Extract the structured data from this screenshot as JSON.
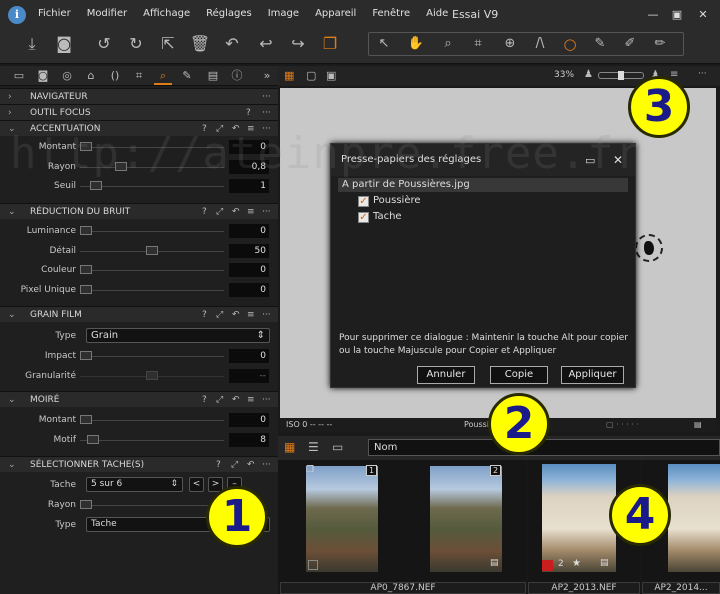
{
  "app": {
    "title": "Essai V9"
  },
  "menu": [
    "Fichier",
    "Modifier",
    "Affichage",
    "Réglages",
    "Image",
    "Appareil",
    "Fenêtre",
    "Aide"
  ],
  "watermark": "http://ateinpre.free.fr",
  "viewer": {
    "zoom": "33%",
    "info_left": "ISO 0 -- -- --",
    "info_center": "Poussi"
  },
  "sections": {
    "navigateur": "NAVIGATEUR",
    "outil_focus": "OUTIL FOCUS",
    "accentuation": {
      "title": "ACCENTUATION",
      "rows": [
        {
          "label": "Montant",
          "value": "0"
        },
        {
          "label": "Rayon",
          "value": "0,8"
        },
        {
          "label": "Seuil",
          "value": "1"
        }
      ]
    },
    "reduction": {
      "title": "RÉDUCTION DU BRUIT",
      "rows": [
        {
          "label": "Luminance",
          "value": "0"
        },
        {
          "label": "Détail",
          "value": "50"
        },
        {
          "label": "Couleur",
          "value": "0"
        },
        {
          "label": "Pixel Unique",
          "value": "0"
        }
      ]
    },
    "grain": {
      "title": "GRAIN FILM",
      "type_label": "Type",
      "type_value": "Grain",
      "rows": [
        {
          "label": "Impact",
          "value": "0"
        },
        {
          "label": "Granularité",
          "value": "--"
        }
      ]
    },
    "moire": {
      "title": "MOIRÉ",
      "rows": [
        {
          "label": "Montant",
          "value": "0"
        },
        {
          "label": "Motif",
          "value": "8"
        }
      ]
    },
    "tache": {
      "title": "SÉLECTIONNER TACHE(S)",
      "tache_label": "Tache",
      "tache_value": "5 sur 6",
      "prev": "<",
      "next": ">",
      "rayon_label": "Rayon",
      "type_label": "Type",
      "type_value": "Tache"
    }
  },
  "dialog": {
    "title": "Presse-papiers des réglages",
    "source": "A partir de Poussières.jpg",
    "items": [
      "Poussière",
      "Tache"
    ],
    "message": "Pour supprimer ce dialogue : Maintenir la touche Alt pour copier ou la touche Majuscule pour Copier et Appliquer",
    "buttons": {
      "cancel": "Annuler",
      "copy": "Copie",
      "apply": "Appliquer"
    }
  },
  "browser": {
    "sort": "Nom"
  },
  "thumbnails": [
    {
      "name": "AP0_7867.NEF",
      "badge": "1"
    },
    {
      "name": "",
      "badge": "2"
    },
    {
      "name": "AP2_2013.NEF",
      "rating": "2"
    },
    {
      "name": "AP2_2014..."
    }
  ],
  "callouts": [
    "1",
    "2",
    "3",
    "4"
  ],
  "colors": {
    "accent": "#e07b1a",
    "panel": "#1f1f1f",
    "callout": "#ffff00"
  }
}
